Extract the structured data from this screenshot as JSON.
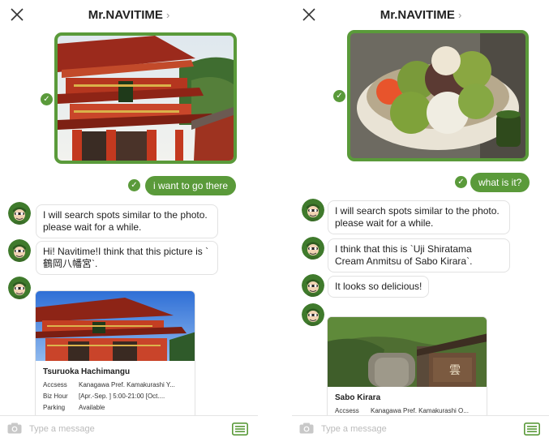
{
  "colors": {
    "accent": "#5a9a3a",
    "bubble_border": "#e2e2e2",
    "placeholder": "#bbbbbb"
  },
  "left": {
    "header": {
      "title": "Mr.NAVITIME",
      "chevron": "›"
    },
    "user_message": "i want to go there",
    "bot_messages": [
      "I will search spots similar to the photo. please wait for a while.",
      "Hi! Navitime!I think that this picture is `鶴岡八幡宮`."
    ],
    "card": {
      "title": "Tsuruoka Hachimangu",
      "rows": [
        {
          "label": "Accsess",
          "value": "Kanagawa Pref. Kamakurashi Y..."
        },
        {
          "label": "Biz Hour",
          "value": "[Apr.-Sep. ] 5:00-21:00 [Oct...."
        },
        {
          "label": "Parking",
          "value": "Available"
        }
      ]
    },
    "input": {
      "placeholder": "Type a message"
    }
  },
  "right": {
    "header": {
      "title": "Mr.NAVITIME",
      "chevron": "›"
    },
    "user_message": "what is it?",
    "bot_messages": [
      "I will search spots similar to the photo. please wait for a while.",
      "I think that this is `Uji Shiratama Cream Anmitsu of Sabo Kirara`.",
      "It looks so delicious!"
    ],
    "card": {
      "title": "Sabo Kirara",
      "rows": [
        {
          "label": "Accsess",
          "value": "Kanagawa Pref. Kamakurashi O..."
        }
      ]
    },
    "input": {
      "placeholder": "Type a message"
    }
  },
  "icons": {
    "close": "close-icon",
    "chevron": "chevron-right-icon",
    "check": "check-icon",
    "avatar": "navitime-character-avatar",
    "camera": "camera-icon",
    "menu": "keyboard-menu-icon"
  }
}
